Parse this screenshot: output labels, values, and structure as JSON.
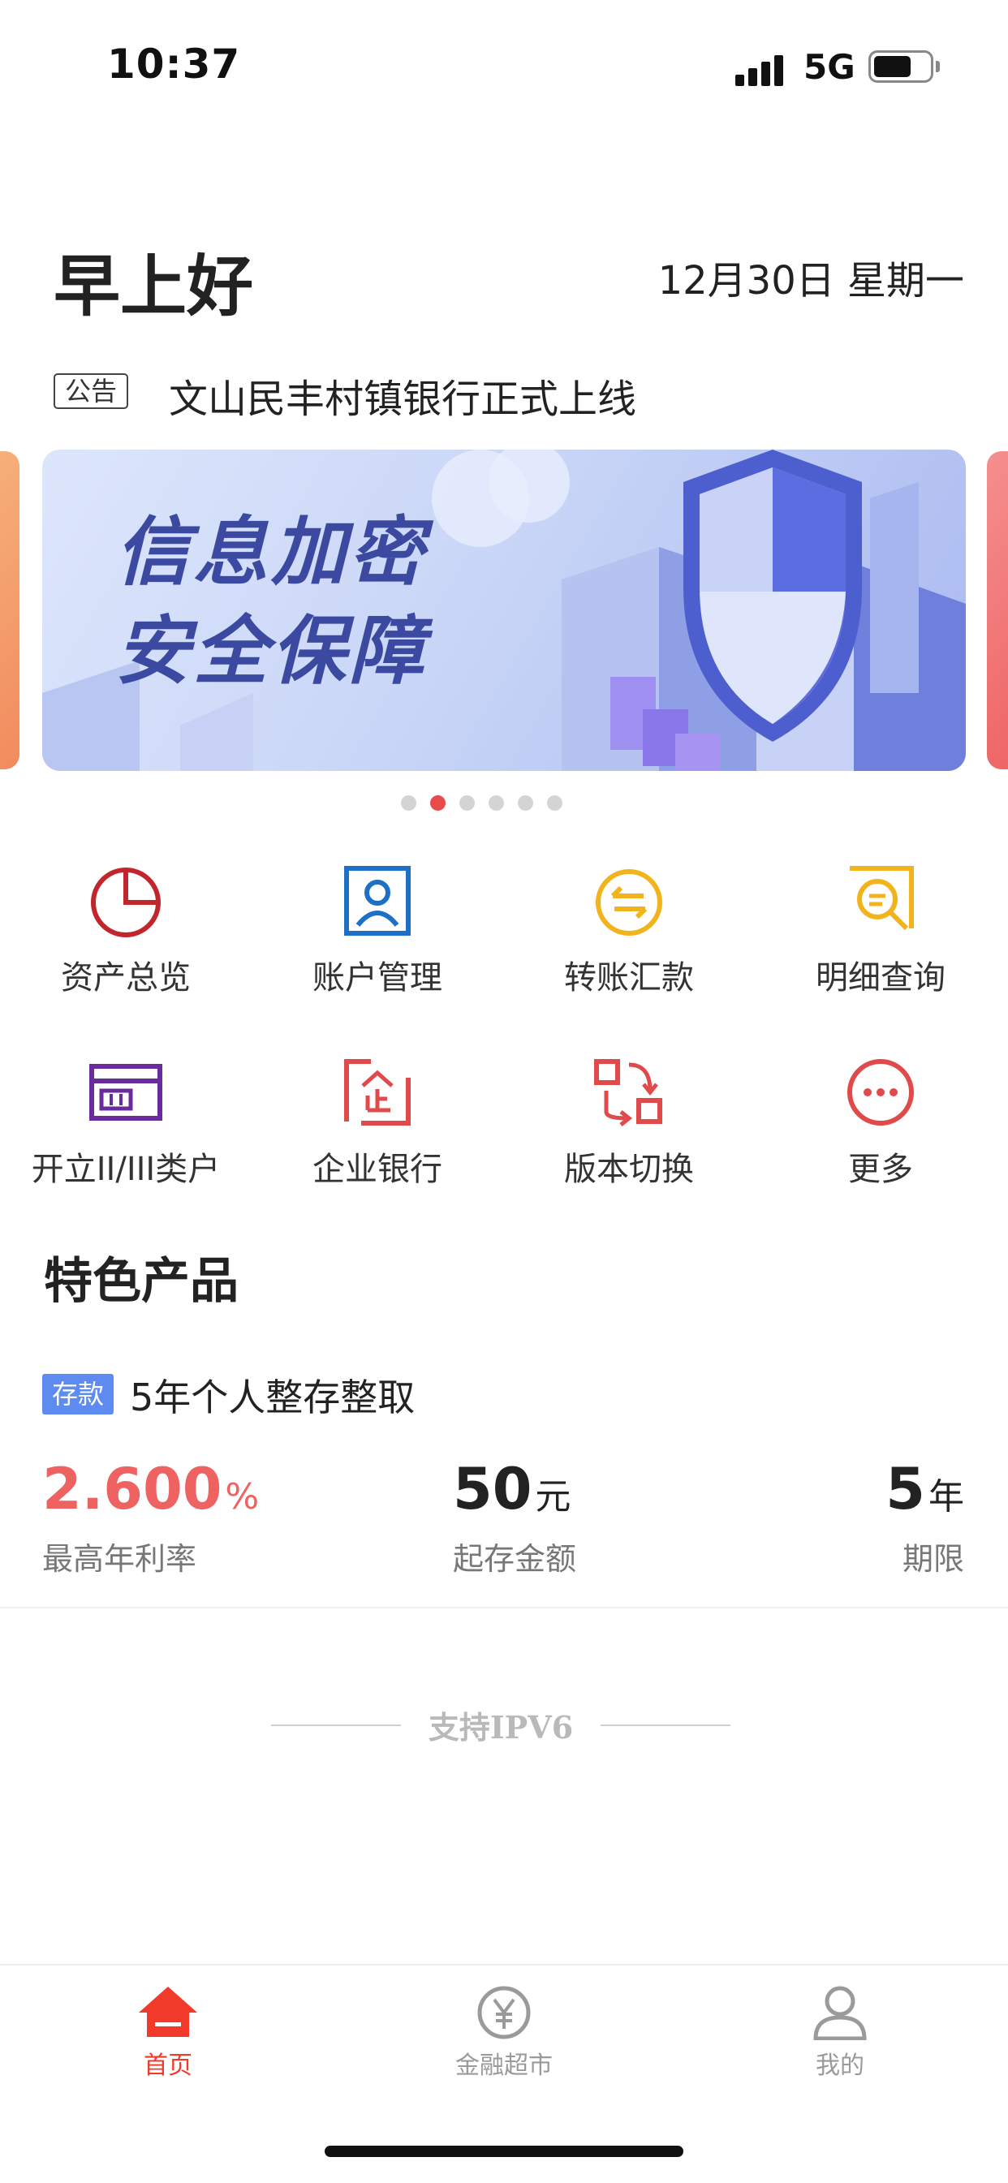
{
  "status_bar": {
    "time": "10:37",
    "network": "5G"
  },
  "header": {
    "greeting": "早上好",
    "date": "12月30日 星期一"
  },
  "notice": {
    "tag": "公告",
    "text": "文山民丰村镇银行正式上线"
  },
  "banner": {
    "title": "信息加密\n安全保障",
    "page_count": 6,
    "active_index": 1
  },
  "menu": [
    {
      "label": "资产总览",
      "icon": "pie-chart-icon",
      "color": "#c0262b"
    },
    {
      "label": "账户管理",
      "icon": "account-user-icon",
      "color": "#1e6fc6"
    },
    {
      "label": "转账汇款",
      "icon": "transfer-icon",
      "color": "#f2b41c"
    },
    {
      "label": "明细查询",
      "icon": "detail-search-icon",
      "color": "#f2b41c"
    },
    {
      "label": "开立II/III类户",
      "icon": "card-icon",
      "color": "#6a2c9c"
    },
    {
      "label": "企业银行",
      "icon": "enterprise-icon",
      "color": "#e04a4a"
    },
    {
      "label": "版本切换",
      "icon": "switch-icon",
      "color": "#e04a4a"
    },
    {
      "label": "更多",
      "icon": "more-icon",
      "color": "#e04a4a"
    }
  ],
  "featured": {
    "title": "特色产品",
    "product": {
      "tag": "存款",
      "name": "5年个人整存整取",
      "rate_value": "2.600",
      "rate_unit": "%",
      "rate_label": "最高年利率",
      "min_value": "50",
      "min_unit": "元",
      "min_label": "起存金额",
      "term_value": "5",
      "term_unit": "年",
      "term_label": "期限"
    }
  },
  "footer_note": "支持IPV6",
  "tabbar": {
    "items": [
      {
        "label": "首页",
        "icon": "home-icon",
        "active": true
      },
      {
        "label": "金融超市",
        "icon": "yuan-icon",
        "active": false
      },
      {
        "label": "我的",
        "icon": "user-icon",
        "active": false
      }
    ],
    "active_color": "#f23a2b",
    "inactive_color": "#9a9a9a"
  }
}
